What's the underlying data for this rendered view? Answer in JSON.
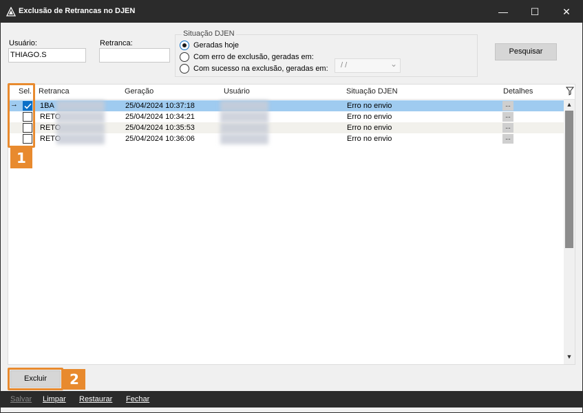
{
  "window": {
    "title": "Exclusão de Retrancas no DJEN",
    "minimize_glyph": "—",
    "maximize_glyph": "☐",
    "close_glyph": "✕"
  },
  "filters": {
    "usuario_label": "Usuário:",
    "usuario_value": "THIAGO.S",
    "retranca_label": "Retranca:",
    "retranca_value": "",
    "situacao_group_title": "Situação DJEN",
    "radio_options": [
      {
        "label": "Geradas hoje",
        "checked": true
      },
      {
        "label": "Com erro de exclusão, geradas em:",
        "checked": false
      },
      {
        "label": "Com sucesso na exclusão, geradas em:",
        "checked": false
      }
    ],
    "date_value": "/ /",
    "search_button": "Pesquisar"
  },
  "grid": {
    "columns": [
      "Sel.",
      "Retranca",
      "Geração",
      "Usuário",
      "Situação DJEN",
      "Detalhes"
    ],
    "rows": [
      {
        "selected_row": true,
        "checked": true,
        "retranca": "1BA",
        "geracao": "25/04/2024 10:37:18",
        "situacao": "Erro no envio",
        "detalhes": "..."
      },
      {
        "selected_row": false,
        "checked": false,
        "retranca": "RETO",
        "geracao": "25/04/2024 10:34:21",
        "situacao": "Erro no envio",
        "detalhes": "..."
      },
      {
        "selected_row": false,
        "checked": false,
        "retranca": "RETO",
        "geracao": "25/04/2024 10:35:53",
        "situacao": "Erro no envio",
        "detalhes": "..."
      },
      {
        "selected_row": false,
        "checked": false,
        "retranca": "RETO",
        "geracao": "25/04/2024 10:36:06",
        "situacao": "Erro no envio",
        "detalhes": "..."
      }
    ],
    "current_row_indicator": "→"
  },
  "actions": {
    "excluir_button": "Excluir"
  },
  "callouts": [
    {
      "number": "1"
    },
    {
      "number": "2"
    }
  ],
  "bottombar": {
    "items": [
      "Salvar",
      "Limpar",
      "Restaurar",
      "Fechar"
    ],
    "disabled": [
      "Salvar"
    ]
  },
  "colors": {
    "callout": "#e88a2e",
    "selected_row": "#9fcbf0",
    "checkbox_checked": "#0b6fc7",
    "titlebar": "#2b2b2b"
  }
}
